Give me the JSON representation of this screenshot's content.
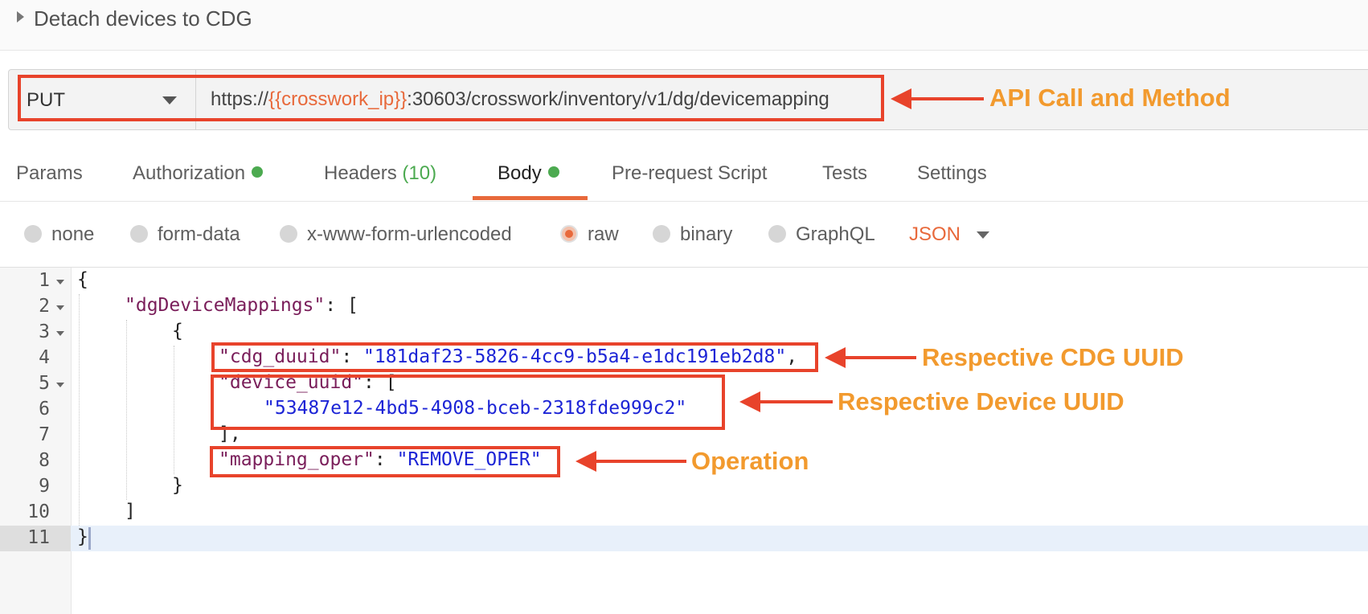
{
  "header": {
    "title": "Detach devices to CDG"
  },
  "request": {
    "method": "PUT",
    "url_prefix": "https://",
    "url_var": "{{crosswork_ip}}",
    "url_suffix": ":30603/crosswork/inventory/v1/dg/devicemapping"
  },
  "tabs": [
    {
      "label": "Params"
    },
    {
      "label": "Authorization"
    },
    {
      "label": "Headers",
      "count": "(10)"
    },
    {
      "label": "Body"
    },
    {
      "label": "Pre-request Script"
    },
    {
      "label": "Tests"
    },
    {
      "label": "Settings"
    }
  ],
  "body_types": [
    "none",
    "form-data",
    "x-www-form-urlencoded",
    "raw",
    "binary",
    "GraphQL"
  ],
  "body_format": "JSON",
  "editor": {
    "line_numbers": [
      "1",
      "2",
      "3",
      "4",
      "5",
      "6",
      "7",
      "8",
      "9",
      "10",
      "11"
    ],
    "lines": {
      "l1": "{",
      "l2_key": "\"dgDeviceMappings\"",
      "l2_rest": ": [",
      "l3": "{",
      "l4_key": "\"cdg_duuid\"",
      "l4_sep": ": ",
      "l4_val": "\"181daf23-5826-4cc9-b5a4-e1dc191eb2d8\"",
      "l4_end": ",",
      "l5_key": "\"device_uuid\"",
      "l5_rest": ": [",
      "l6_val": "\"53487e12-4bd5-4908-bceb-2318fde999c2\"",
      "l7": "],",
      "l8_key": "\"mapping_oper\"",
      "l8_sep": ": ",
      "l8_val": "\"REMOVE_OPER\"",
      "l9": "}",
      "l10": "]",
      "l11": "}"
    }
  },
  "annotations": {
    "api": "API Call and Method",
    "cdg": "Respective CDG UUID",
    "device": "Respective Device UUID",
    "operation": "Operation"
  },
  "colors": {
    "accent": "#e8693b",
    "annotation_box": "#e8432b",
    "annotation_text": "#f29a2e",
    "status_dot": "#4caa50",
    "json_key": "#7a1e5a",
    "json_string": "#1c24d6"
  }
}
